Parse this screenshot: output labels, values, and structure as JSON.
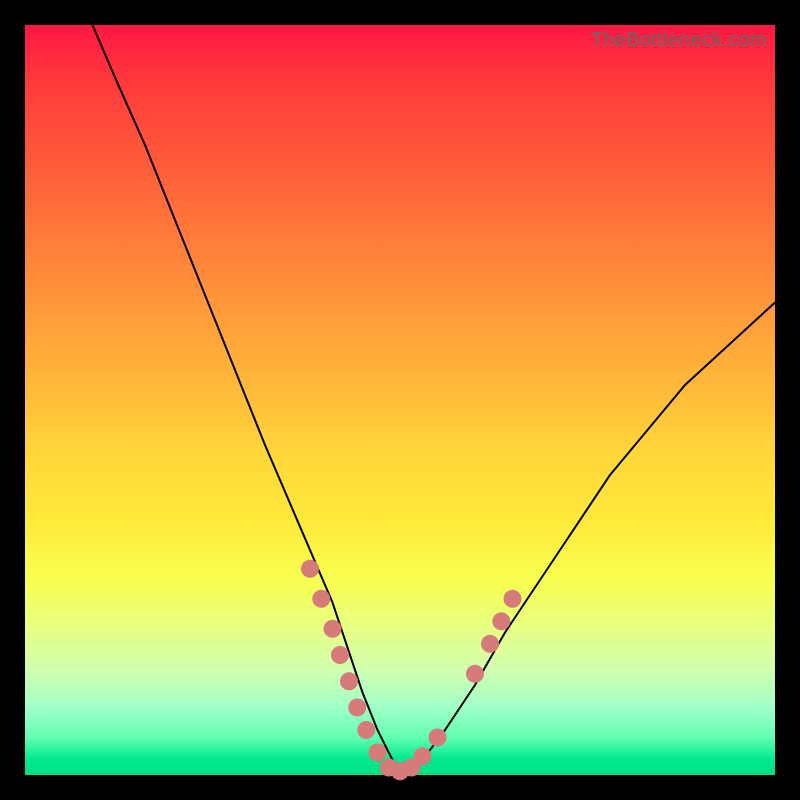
{
  "watermark": "TheBottleneck.com",
  "chart_data": {
    "type": "line",
    "title": "",
    "xlabel": "",
    "ylabel": "",
    "xlim": [
      0,
      100
    ],
    "ylim": [
      0,
      100
    ],
    "grid": false,
    "curve": {
      "description": "V-shaped bottleneck curve descending steeply from top-left to a trough near x≈47–52% at y≈0, then rising toward upper-right.",
      "x": [
        9,
        12,
        16,
        20,
        24,
        28,
        32,
        35,
        38,
        41,
        43,
        45,
        47,
        49,
        51,
        53,
        56,
        60,
        64,
        70,
        78,
        88,
        100
      ],
      "y": [
        100,
        93,
        84,
        74,
        64,
        54,
        44,
        37,
        30,
        23,
        17,
        11,
        6,
        2,
        0,
        2,
        6,
        12,
        19,
        28,
        40,
        52,
        63
      ]
    },
    "dots": {
      "description": "Data markers clustered around the trough and lower slopes",
      "points": [
        {
          "x": 38.0,
          "y": 27.5
        },
        {
          "x": 39.5,
          "y": 23.5
        },
        {
          "x": 41.0,
          "y": 19.5
        },
        {
          "x": 42.0,
          "y": 16.0
        },
        {
          "x": 43.2,
          "y": 12.5
        },
        {
          "x": 44.3,
          "y": 9.0
        },
        {
          "x": 45.5,
          "y": 6.0
        },
        {
          "x": 47.0,
          "y": 3.0
        },
        {
          "x": 48.5,
          "y": 1.0
        },
        {
          "x": 50.0,
          "y": 0.5
        },
        {
          "x": 51.5,
          "y": 1.0
        },
        {
          "x": 53.0,
          "y": 2.5
        },
        {
          "x": 55.0,
          "y": 5.0
        },
        {
          "x": 60.0,
          "y": 13.5
        },
        {
          "x": 62.0,
          "y": 17.5
        },
        {
          "x": 63.5,
          "y": 20.5
        },
        {
          "x": 65.0,
          "y": 23.5
        }
      ],
      "radius_px": 9
    },
    "background_gradient": {
      "top": "#ff1744",
      "mid": "#ffd93a",
      "bottom": "#00e080"
    }
  }
}
